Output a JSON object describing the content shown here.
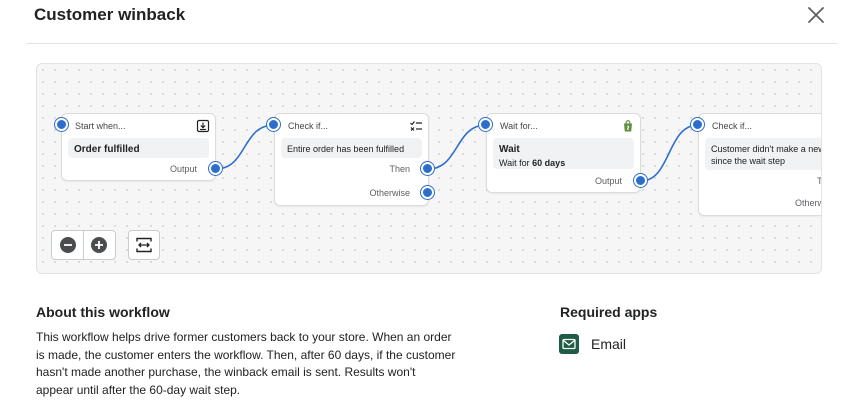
{
  "modal": {
    "title": "Customer winback",
    "close_icon": "close-icon"
  },
  "workflow": {
    "nodes": [
      {
        "header": "Start when...",
        "icon": "import-icon",
        "body_title": "Order fulfilled",
        "ports": [
          "Output"
        ]
      },
      {
        "header": "Check if...",
        "icon": "checklist-icon",
        "body_text": "Entire order has been fulfilled",
        "ports": [
          "Then",
          "Otherwise"
        ]
      },
      {
        "header": "Wait for...",
        "icon": "shopify-bag-icon",
        "body_title": "Wait",
        "body_text_prefix": "Wait for ",
        "body_text_bold": "60 days",
        "ports": [
          "Output"
        ]
      },
      {
        "header": "Check if...",
        "body_text_line1": "Customer didn't make a new o",
        "body_text_line2": "since the wait step",
        "ports": [
          "T",
          "Otherw"
        ]
      }
    ],
    "controls": {
      "zoom_out_icon": "minus-circle-icon",
      "zoom_in_icon": "plus-circle-icon",
      "fit_icon": "fit-view-icon"
    }
  },
  "about": {
    "title": "About this workflow",
    "description": "This workflow helps drive former customers back to your store. When an order is made, the customer enters the workflow. Then, after 60 days, if the customer hasn't made another purchase, the winback email is sent. Results won't appear until after the 60-day wait step."
  },
  "required_apps": {
    "title": "Required apps",
    "apps": [
      {
        "name": "Email",
        "icon": "email-icon",
        "color": "#1f5c44"
      }
    ]
  },
  "colors": {
    "accent": "#2c6ecb",
    "canvas_bg": "#f6f6f7"
  }
}
